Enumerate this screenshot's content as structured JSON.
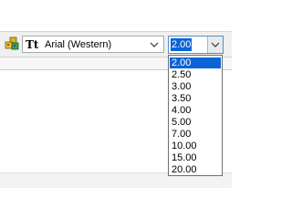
{
  "toolbar": {
    "style_icon": "color-blocks-icon",
    "font": {
      "icon": "truetype-font-icon",
      "type_glyph": "Tt",
      "value": "Arial (Western)",
      "arrow_icon": "chevron-down-icon"
    },
    "size": {
      "value": "2.00",
      "arrow_icon": "chevron-down-icon"
    }
  },
  "size_dropdown": {
    "selected": "2.00",
    "options": [
      "2.00",
      "2.50",
      "3.00",
      "3.50",
      "4.00",
      "5.00",
      "7.00",
      "10.00",
      "15.00",
      "20.00"
    ]
  },
  "colors": {
    "selection": "#0a64d6",
    "toolbar_bg": "#f0f0f0",
    "combo_focus_border": "#5a8cc7"
  }
}
